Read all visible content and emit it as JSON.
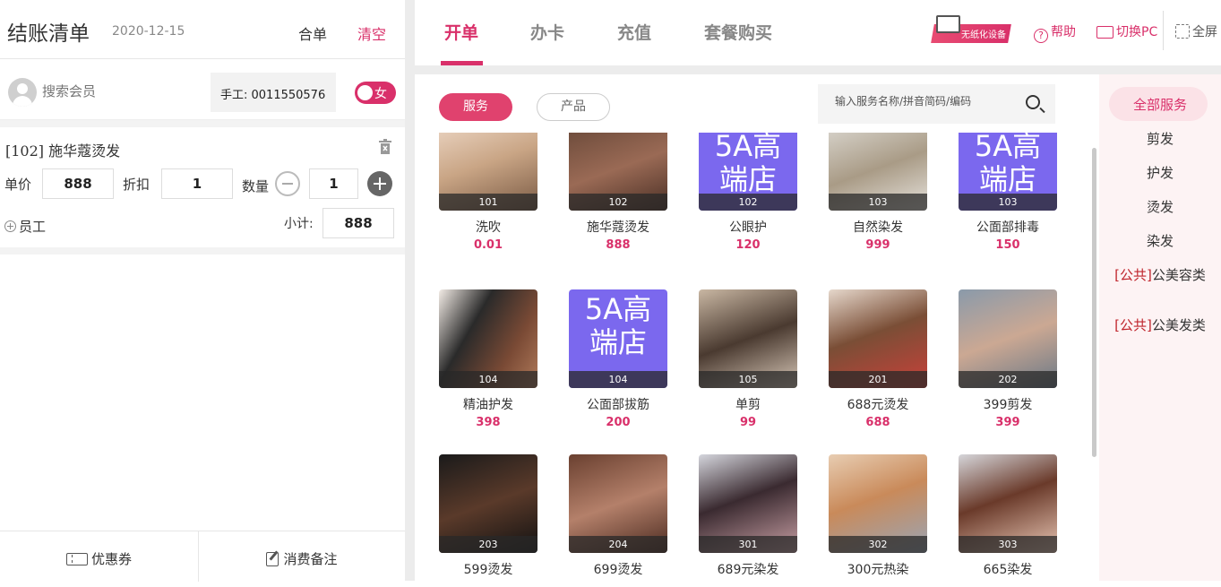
{
  "left": {
    "title": "结账清单",
    "date": "2020-12-15",
    "merge_label": "合单",
    "clear_label": "清空",
    "member_search_placeholder": "搜索会员",
    "manual_label": "手工: 0011550576",
    "gender_label": "女",
    "order_item": {
      "name": "[102]  施华蔻烫发",
      "unit_price_label": "单价",
      "unit_price": "888",
      "discount_label": "折扣",
      "discount": "1",
      "qty_label": "数量",
      "qty": "1",
      "staff_label": "员工",
      "subtotal_label": "小计:",
      "subtotal": "888"
    },
    "coupon_label": "优惠券",
    "note_label": "消费备注"
  },
  "tabs": [
    {
      "label": "开单",
      "active": true
    },
    {
      "label": "办卡",
      "active": false
    },
    {
      "label": "充值",
      "active": false
    },
    {
      "label": "套餐购买",
      "active": false
    }
  ],
  "toolbar": {
    "nopaper_label": "无纸化设备",
    "help_label": "帮助",
    "switch_pc_label": "切换PC",
    "fullscreen_label": "全屏"
  },
  "filters": {
    "service_label": "服务",
    "product_label": "产品",
    "search_placeholder": "输入服务名称/拼音简码/编码"
  },
  "services": [
    {
      "code": "101",
      "name": "洗吹",
      "price": "0.01",
      "img": "photo"
    },
    {
      "code": "102",
      "name": "施华蔻烫发",
      "price": "888",
      "img": "photo"
    },
    {
      "code": "102",
      "name": "公眼护",
      "price": "120",
      "img": "5a",
      "placeholder": "5A高\n端店"
    },
    {
      "code": "103",
      "name": "自然染发",
      "price": "999",
      "img": "photo"
    },
    {
      "code": "103",
      "name": "公面部排毒",
      "price": "150",
      "img": "5a",
      "placeholder": "5A高\n端店"
    },
    {
      "code": "104",
      "name": "精油护发",
      "price": "398",
      "img": "photo"
    },
    {
      "code": "104",
      "name": "公面部拔筋",
      "price": "200",
      "img": "5a",
      "placeholder": "5A高\n端店"
    },
    {
      "code": "105",
      "name": "单剪",
      "price": "99",
      "img": "photo"
    },
    {
      "code": "201",
      "name": "688元烫发",
      "price": "688",
      "img": "photo"
    },
    {
      "code": "202",
      "name": "399剪发",
      "price": "399",
      "img": "photo"
    },
    {
      "code": "203",
      "name": "599烫发",
      "price": "",
      "img": "photo"
    },
    {
      "code": "204",
      "name": "699烫发",
      "price": "",
      "img": "photo"
    },
    {
      "code": "301",
      "name": "689元染发",
      "price": "",
      "img": "photo"
    },
    {
      "code": "302",
      "name": "300元热染",
      "price": "",
      "img": "photo"
    },
    {
      "code": "303",
      "name": "665染发",
      "price": "",
      "img": "photo"
    }
  ],
  "categories": [
    {
      "label": "全部服务",
      "selected": true
    },
    {
      "label": "剪发"
    },
    {
      "label": "护发"
    },
    {
      "label": "烫发"
    },
    {
      "label": "染发"
    },
    {
      "prefix": "[公共]",
      "label": "公美容类"
    },
    {
      "prefix": "[公共]",
      "label": "公美发类"
    }
  ],
  "colors": {
    "accent": "#d9306a",
    "placeholder_purple": "#7b68ee"
  }
}
